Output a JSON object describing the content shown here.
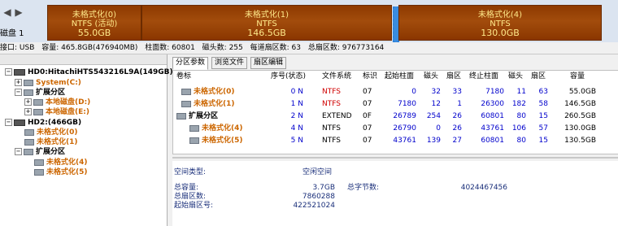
{
  "top": {
    "disk_label": "磁盘 1",
    "partitions": [
      {
        "name": "未格式化(0)",
        "fs": "NTFS (活动)",
        "size": "55.0GB"
      },
      {
        "name": "未格式化(1)",
        "fs": "NTFS",
        "size": "146.5GB"
      },
      {
        "name": "未格式化(4)",
        "fs": "NTFS",
        "size": "130.0GB"
      }
    ]
  },
  "info": {
    "iface": "接口: USB",
    "capacity": "容量: 465.8GB(476940MB)",
    "cylinders": "柱面数: 60801",
    "heads": "磁头数: 255",
    "sectors_per_track": "每道扇区数: 63",
    "total_sectors": "总扇区数: 976773164"
  },
  "tree": {
    "hd0": "HD0:HitachiHTS543216L9A(149GB)",
    "system": "System(C:)",
    "ext": "扩展分区",
    "d": "本地磁盘(D:)",
    "e": "本地磁盘(E:)",
    "hd2": "HD2:(466GB)",
    "u0": "未格式化(0)",
    "u1": "未格式化(1)",
    "ext2": "扩展分区",
    "u4": "未格式化(4)",
    "u5": "未格式化(5)"
  },
  "tabs": [
    "分区参数",
    "浏览文件",
    "扇区编辑"
  ],
  "grid": {
    "headers": [
      "卷标",
      "序号(状态)",
      "文件系统",
      "标识",
      "起始柱面",
      "磁头",
      "扇区",
      "终止柱面",
      "磁头",
      "扇区",
      "容量"
    ],
    "rows": [
      {
        "name": "未格式化(0)",
        "idx": "0 N",
        "fs": "NTFS",
        "id": "07",
        "sc": "0",
        "sh": "32",
        "ss": "33",
        "ec": "7180",
        "eh": "11",
        "es": "63",
        "cap": "55.0GB"
      },
      {
        "name": "未格式化(1)",
        "idx": "1 N",
        "fs": "NTFS",
        "id": "07",
        "sc": "7180",
        "sh": "12",
        "ss": "1",
        "ec": "26300",
        "eh": "182",
        "es": "58",
        "cap": "146.5GB"
      },
      {
        "name": "扩展分区",
        "idx": "2 N",
        "fs": "EXTEND",
        "id": "0F",
        "sc": "26789",
        "sh": "254",
        "ss": "26",
        "ec": "60801",
        "eh": "80",
        "es": "15",
        "cap": "260.5GB"
      },
      {
        "name": "未格式化(4)",
        "idx": "4 N",
        "fs": "NTFS",
        "id": "07",
        "sc": "26790",
        "sh": "0",
        "ss": "26",
        "ec": "43761",
        "eh": "106",
        "es": "57",
        "cap": "130.0GB"
      },
      {
        "name": "未格式化(5)",
        "idx": "5 N",
        "fs": "NTFS",
        "id": "07",
        "sc": "43761",
        "sh": "139",
        "ss": "27",
        "ec": "60801",
        "eh": "80",
        "es": "15",
        "cap": "130.5GB"
      }
    ]
  },
  "bottom": {
    "space_type_label": "空间类型:",
    "space_type_value": "空闲空间",
    "total_cap_label": "总容量:",
    "total_cap_value": "3.7GB",
    "total_bytes_label": "总字节数:",
    "total_bytes_value": "4024467456",
    "total_sectors_label": "总扇区数:",
    "total_sectors_value": "7860288",
    "start_sector_label": "起始扇区号:",
    "start_sector_value": "422521024"
  }
}
